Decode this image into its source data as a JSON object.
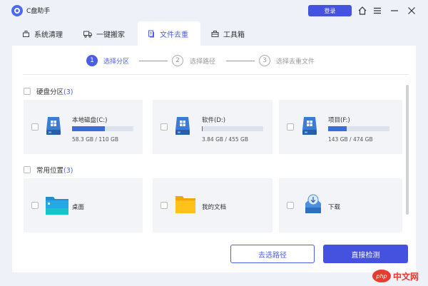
{
  "app": {
    "title": "C盘助手"
  },
  "titlebar": {
    "login_label": "登录"
  },
  "tabs": [
    {
      "label": "系统清理",
      "icon": "broom-icon"
    },
    {
      "label": "一键搬家",
      "icon": "truck-icon"
    },
    {
      "label": "文件去重",
      "icon": "file-copy-icon",
      "active": true
    },
    {
      "label": "工具箱",
      "icon": "toolbox-icon"
    }
  ],
  "steps": [
    {
      "num": "1",
      "label": "选择分区",
      "active": true
    },
    {
      "num": "2",
      "label": "选择路径",
      "active": false
    },
    {
      "num": "3",
      "label": "选择去重文件",
      "active": false
    }
  ],
  "disk_section": {
    "title": "硬盘分区",
    "count": "(3)",
    "disks": [
      {
        "name": "本地磁盘(C:)",
        "size": "58.3 GB / 110 GB",
        "used_fraction": 0.53
      },
      {
        "name": "软件(D:)",
        "size": "3.84 GB / 455 GB",
        "used_fraction": 0.01
      },
      {
        "name": "项目(F:)",
        "size": "143 GB / 474 GB",
        "used_fraction": 0.3
      }
    ]
  },
  "location_section": {
    "title": "常用位置",
    "count": "(3)",
    "locations": [
      {
        "name": "桌面",
        "icon": "desktop-folder-icon"
      },
      {
        "name": "我的文档",
        "icon": "documents-folder-icon"
      },
      {
        "name": "下载",
        "icon": "download-icon"
      }
    ]
  },
  "buttons": {
    "choose_path": "去选路径",
    "scan_now": "直接检测"
  },
  "watermark": {
    "badge": "php",
    "text": "中文网"
  },
  "colors": {
    "accent": "#4b5ee8",
    "bar_fill": "#3e6bdc",
    "card_bg": "#f3f4f7"
  }
}
